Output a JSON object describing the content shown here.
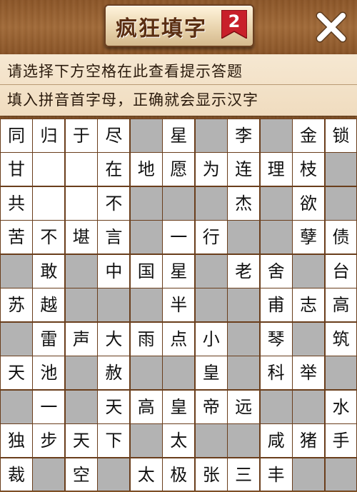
{
  "header": {
    "game_title": "疯狂填字",
    "level_badge": "2",
    "close_label": "✕"
  },
  "hint_panel": {
    "line1": "请选择下方空格在此查看提示答题",
    "line2": "填入拼音首字母，正确就会显示汉字"
  },
  "board": {
    "rows": 11,
    "cols": 11,
    "cells": [
      [
        "同",
        "归",
        "于",
        "尽",
        null,
        "星",
        null,
        "李",
        null,
        "金",
        "锁"
      ],
      [
        "甘",
        "",
        "",
        "在",
        "地",
        "愿",
        "为",
        "连",
        "理",
        "枝",
        null
      ],
      [
        "共",
        "",
        "",
        "不",
        null,
        null,
        null,
        "杰",
        null,
        "欲",
        null
      ],
      [
        "苦",
        "不",
        "堪",
        "言",
        null,
        "一",
        "行",
        null,
        null,
        "孽",
        "债"
      ],
      [
        null,
        "敢",
        null,
        "中",
        "国",
        "星",
        null,
        "老",
        "舍",
        null,
        "台"
      ],
      [
        "苏",
        "越",
        null,
        null,
        null,
        "半",
        null,
        null,
        "甫",
        "志",
        "高"
      ],
      [
        null,
        "雷",
        "声",
        "大",
        "雨",
        "点",
        "小",
        null,
        "琴",
        null,
        "筑"
      ],
      [
        "天",
        "池",
        null,
        "赦",
        null,
        null,
        "皇",
        null,
        "科",
        "举",
        null
      ],
      [
        null,
        "一",
        null,
        "天",
        "高",
        "皇",
        "帝",
        "远",
        null,
        null,
        "水"
      ],
      [
        "独",
        "步",
        "天",
        "下",
        null,
        "太",
        null,
        null,
        "咸",
        "猪",
        "手"
      ],
      [
        "裁",
        null,
        "空",
        null,
        "太",
        "极",
        "张",
        "三",
        "丰",
        null,
        null
      ]
    ]
  },
  "colors": {
    "blank_cell": "#b3b3b3",
    "open_cell": "#ffffff",
    "wood": "#8b5a2b",
    "badge": "#c8202a"
  }
}
